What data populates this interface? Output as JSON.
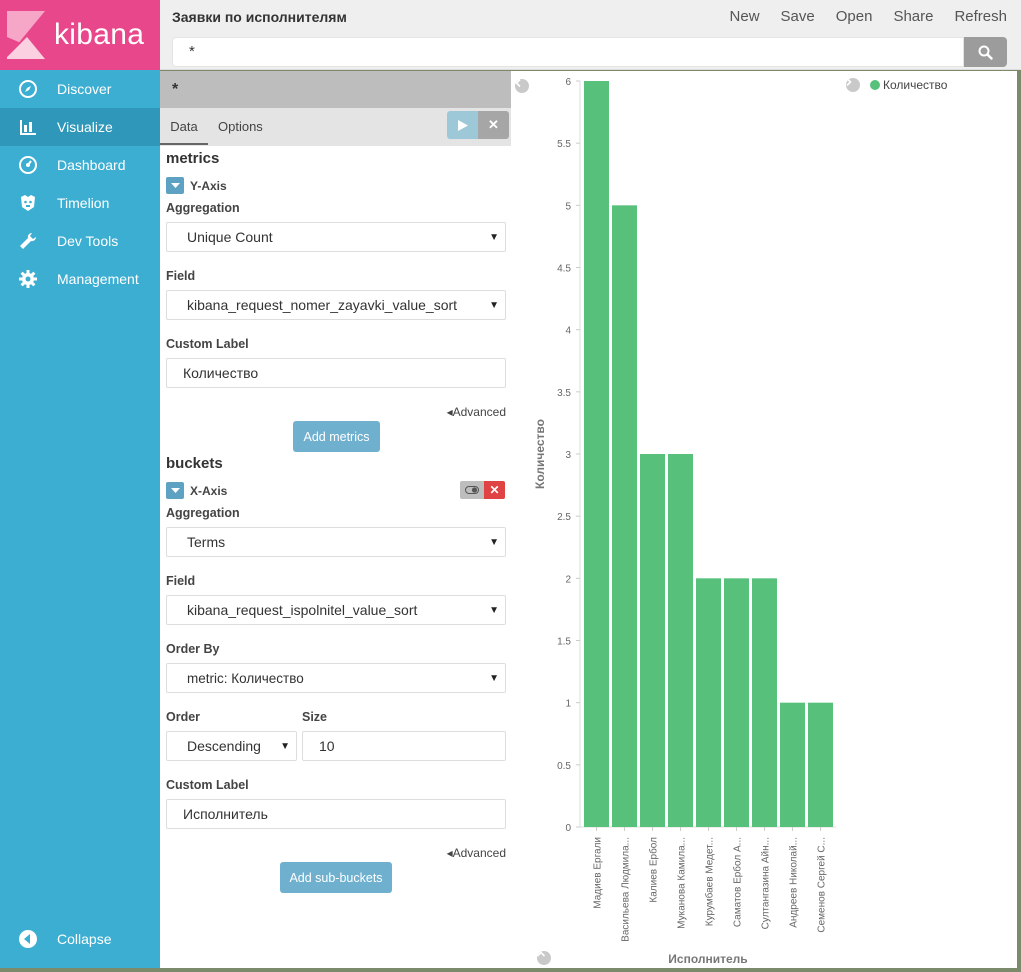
{
  "app": {
    "logo_text": "kibana"
  },
  "sidebar": {
    "items": [
      {
        "label": "Discover",
        "icon": "compass-icon"
      },
      {
        "label": "Visualize",
        "icon": "bar-chart-icon"
      },
      {
        "label": "Dashboard",
        "icon": "dashboard-icon"
      },
      {
        "label": "Timelion",
        "icon": "timelion-icon"
      },
      {
        "label": "Dev Tools",
        "icon": "wrench-icon"
      },
      {
        "label": "Management",
        "icon": "gear-icon"
      }
    ],
    "collapse_label": "Collapse"
  },
  "header": {
    "title": "Заявки по исполнителям",
    "menu": {
      "new": "New",
      "save": "Save",
      "open": "Open",
      "share": "Share",
      "refresh": "Refresh"
    },
    "search_value": "*"
  },
  "editor": {
    "query": "*",
    "tabs": {
      "data": "Data",
      "options": "Options"
    },
    "metrics": {
      "title": "metrics",
      "agg_name": "Y-Axis",
      "aggregation_label": "Aggregation",
      "aggregation_value": "Unique Count",
      "field_label": "Field",
      "field_value": "kibana_request_nomer_zayavki_value_sort",
      "custom_label_label": "Custom Label",
      "custom_label_value": "Количество",
      "advanced": "Advanced",
      "add_button": "Add metrics"
    },
    "buckets": {
      "title": "buckets",
      "agg_name": "X-Axis",
      "aggregation_label": "Aggregation",
      "aggregation_value": "Terms",
      "field_label": "Field",
      "field_value": "kibana_request_ispolnitel_value_sort",
      "order_by_label": "Order By",
      "order_by_value": "metric: Количество",
      "order_label": "Order",
      "order_value": "Descending",
      "size_label": "Size",
      "size_value": "10",
      "custom_label_label": "Custom Label",
      "custom_label_value": "Исполнитель",
      "advanced": "Advanced",
      "add_button": "Add sub-buckets"
    }
  },
  "colors": {
    "bar": "#57c17b",
    "sidebar": "#3caed2",
    "logo": "#e8488b"
  },
  "chart_data": {
    "type": "bar",
    "categories": [
      "Мадиев Ергали",
      "Васильева Людмила...",
      "Калиев Ербол",
      "Муканова Камила...",
      "Курумбаев Медет...",
      "Саматов Ербол А...",
      "Султангазина Айн...",
      "Андреев Николай...",
      "Семенов Сергей С..."
    ],
    "series": [
      {
        "name": "Количество",
        "values": [
          6,
          5,
          3,
          3,
          2,
          2,
          2,
          1,
          1
        ]
      }
    ],
    "xlabel": "Исполнитель",
    "ylabel": "Количество",
    "ylim": [
      0,
      6
    ],
    "yticks": [
      "0",
      "0.5",
      "1",
      "1.5",
      "2",
      "2.5",
      "3",
      "3.5",
      "4",
      "4.5",
      "5",
      "5.5",
      "6"
    ],
    "legend": "top-right",
    "grid": false
  }
}
